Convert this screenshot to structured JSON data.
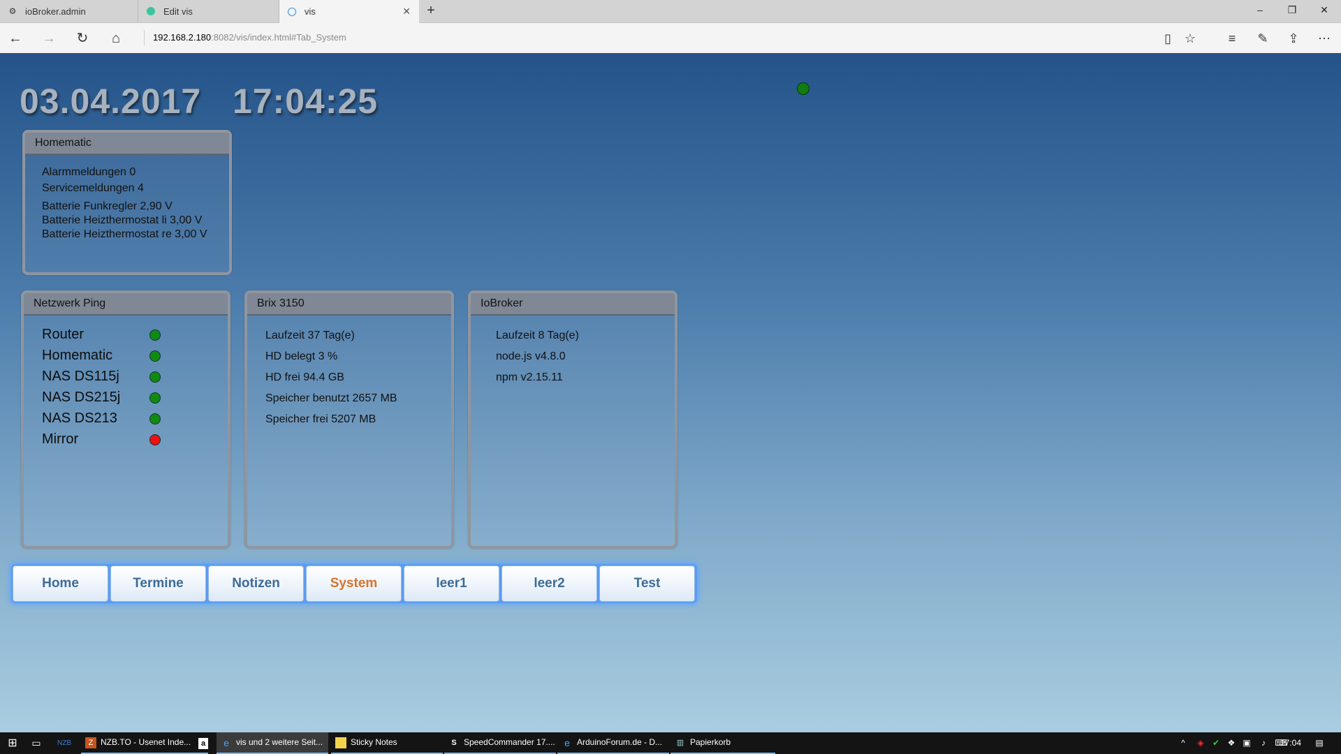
{
  "browser": {
    "tabs": [
      {
        "label": "ioBroker.admin",
        "icon": "gear-icon"
      },
      {
        "label": "Edit vis",
        "icon": "vis-edit-icon"
      },
      {
        "label": "vis",
        "icon": "vis-icon"
      }
    ],
    "new_tab_label": "+",
    "url_host": "192.168.2.180",
    "url_rest": ":8082/vis/index.html#Tab_System",
    "window_controls": {
      "minimize": "–",
      "restore": "❐",
      "close": "✕"
    }
  },
  "vis": {
    "date": "03.04.2017",
    "time": "17:04:25",
    "status_dot_color": "#117c11",
    "homematic": {
      "title": "Homematic",
      "lines": [
        "Alarmmeldungen 0",
        "Servicemeldungen 4",
        "Batterie Funkregler 2,90 V",
        "Batterie Heizthermostat li 3,00 V",
        "Batterie Heizthermostat re 3,00 V"
      ]
    },
    "ping": {
      "title": "Netzwerk Ping",
      "hosts": [
        {
          "name": "Router",
          "status_color": "#118a11"
        },
        {
          "name": "Homematic",
          "status_color": "#118a11"
        },
        {
          "name": "NAS DS115j",
          "status_color": "#118a11"
        },
        {
          "name": "NAS DS215j",
          "status_color": "#118a11"
        },
        {
          "name": "NAS DS213",
          "status_color": "#118a11"
        },
        {
          "name": "Mirror",
          "status_color": "#ee1111"
        }
      ]
    },
    "brix": {
      "title": "Brix 3150",
      "lines": [
        "Laufzeit 37 Tag(e)",
        "HD belegt 3 %",
        "HD frei 94.4 GB",
        "Speicher benutzt 2657 MB",
        "Speicher frei 5207 MB"
      ]
    },
    "iobroker": {
      "title": "IoBroker",
      "lines": [
        "Laufzeit 8 Tag(e)",
        "node.js v4.8.0",
        "npm v2.15.11"
      ]
    },
    "menu": {
      "items": [
        "Home",
        "Termine",
        "Notizen",
        "System",
        "leer1",
        "leer2",
        "Test"
      ],
      "active": "System",
      "active_color": "#d8742b",
      "color": "#3d6b98"
    }
  },
  "taskbar": {
    "items": [
      {
        "label": "NZB.TO - Usenet Inde...",
        "icon": "nzb-icon"
      },
      {
        "label": "",
        "icon": "amazon-icon"
      },
      {
        "label": "vis und 2 weitere Seit...",
        "icon": "edge-icon"
      },
      {
        "label": "Sticky Notes",
        "icon": "sticky-notes-icon"
      },
      {
        "label": "SpeedCommander 17....",
        "icon": "speedcommander-icon"
      },
      {
        "label": "ArduinoForum.de - D...",
        "icon": "ie-icon"
      },
      {
        "label": "Papierkorb",
        "icon": "recycle-bin-icon"
      }
    ],
    "clock": "17:04"
  }
}
